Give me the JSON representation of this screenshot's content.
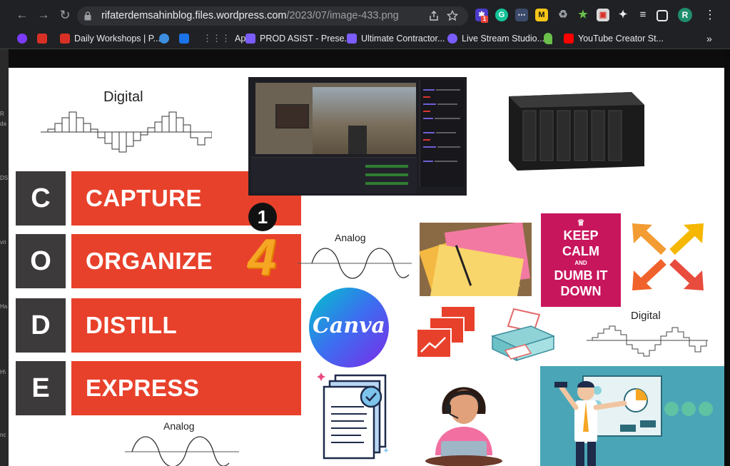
{
  "browser": {
    "url_host": "rifaterdemsahinblog.files.wordpress.com",
    "url_path": "/2023/07/image-433.png",
    "profile_initial": "R",
    "extension_badge": "1",
    "bookmarks": [
      {
        "label": "Daily Workshops | P...",
        "color": "#d93025"
      },
      {
        "label": "Apps",
        "color": "#9aa0a6"
      },
      {
        "label": "PROD ASIST - Prese...",
        "color": "#7b5cff"
      },
      {
        "label": "Ultimate Contractor...",
        "color": "#7b5cff"
      },
      {
        "label": "Live Stream Studio...",
        "color": "#7b5cff"
      },
      {
        "label": "YouTube Creator St...",
        "color": "#ff0000"
      }
    ],
    "more_label": "»"
  },
  "page": {
    "labels": {
      "digital_top": "Digital",
      "analog_mid": "Analog",
      "digital_right": "Digital",
      "analog_bottom": "Analog"
    },
    "code": [
      {
        "letter": "C",
        "word": "CAPTURE"
      },
      {
        "letter": "O",
        "word": "ORGANIZE"
      },
      {
        "letter": "D",
        "word": "DISTILL"
      },
      {
        "letter": "E",
        "word": "EXPRESS"
      }
    ],
    "badge_number": "1",
    "big_number": "4",
    "canva_text": "Canva",
    "keep_calm": [
      "KEEP",
      "CALM",
      "AND",
      "DUMB IT",
      "DOWN"
    ],
    "gutter_text": [
      "R",
      "da",
      "DS",
      "vri",
      "Ha",
      "H\\",
      "nc"
    ]
  }
}
